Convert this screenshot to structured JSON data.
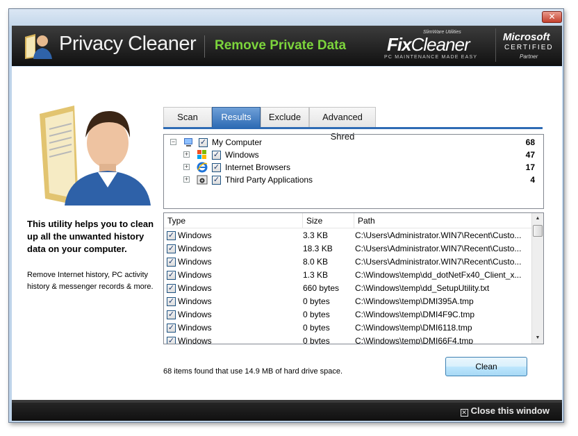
{
  "window": {
    "close_glyph": "✕"
  },
  "banner": {
    "title": "Privacy Cleaner",
    "subtitle": "Remove Private Data",
    "fixcleaner": {
      "small": "SlimWare Utilities",
      "brand_fix": "Fix",
      "brand_cleaner": "Cleaner",
      "tagline": "PC MAINTENANCE MADE EASY"
    },
    "microsoft": {
      "name": "Microsoft",
      "certified": "CERTIFIED",
      "partner": "Partner"
    }
  },
  "description": {
    "main": "This utility helps you to clean up all the unwanted history data on your computer.",
    "sub": "Remove Internet history, PC activity history & messenger records & more."
  },
  "tabs": [
    {
      "label": "Scan",
      "active": false
    },
    {
      "label": "Results",
      "active": true
    },
    {
      "label": "Exclude",
      "active": false
    },
    {
      "label": "Advanced Shred",
      "active": false
    }
  ],
  "tree": {
    "root": {
      "label": "My Computer",
      "count": "68",
      "expander": "−",
      "icon": "computer-icon"
    },
    "children": [
      {
        "label": "Windows",
        "count": "47",
        "expander": "+",
        "icon": "windows-logo-icon"
      },
      {
        "label": "Internet Browsers",
        "count": "17",
        "expander": "+",
        "icon": "internet-explorer-icon"
      },
      {
        "label": "Third Party Applications",
        "count": "4",
        "expander": "+",
        "icon": "application-icon"
      }
    ]
  },
  "table": {
    "headers": [
      "Type",
      "Size",
      "Path"
    ],
    "rows": [
      {
        "type": "Windows",
        "size": "3.3 KB",
        "path": "C:\\Users\\Administrator.WIN7\\Recent\\Custo..."
      },
      {
        "type": "Windows",
        "size": "18.3 KB",
        "path": "C:\\Users\\Administrator.WIN7\\Recent\\Custo..."
      },
      {
        "type": "Windows",
        "size": "8.0 KB",
        "path": "C:\\Users\\Administrator.WIN7\\Recent\\Custo..."
      },
      {
        "type": "Windows",
        "size": "1.3 KB",
        "path": "C:\\Windows\\temp\\dd_dotNetFx40_Client_x..."
      },
      {
        "type": "Windows",
        "size": "660 bytes",
        "path": "C:\\Windows\\temp\\dd_SetupUtility.txt"
      },
      {
        "type": "Windows",
        "size": "0 bytes",
        "path": "C:\\Windows\\temp\\DMI395A.tmp"
      },
      {
        "type": "Windows",
        "size": "0 bytes",
        "path": "C:\\Windows\\temp\\DMI4F9C.tmp"
      },
      {
        "type": "Windows",
        "size": "0 bytes",
        "path": "C:\\Windows\\temp\\DMI6118.tmp"
      },
      {
        "type": "Windows",
        "size": "0 bytes",
        "path": "C:\\Windows\\temp\\DMI66F4.tmp"
      }
    ]
  },
  "status_text": "68 items found that use 14.9 MB of hard drive space.",
  "clean_button": "Clean",
  "footer": {
    "close_label": "Close this window",
    "close_glyph": "✕"
  },
  "colors": {
    "accent_green": "#7cd43c",
    "tab_active": "#2e6bb4",
    "banner_bg": "#1c1c1c"
  }
}
